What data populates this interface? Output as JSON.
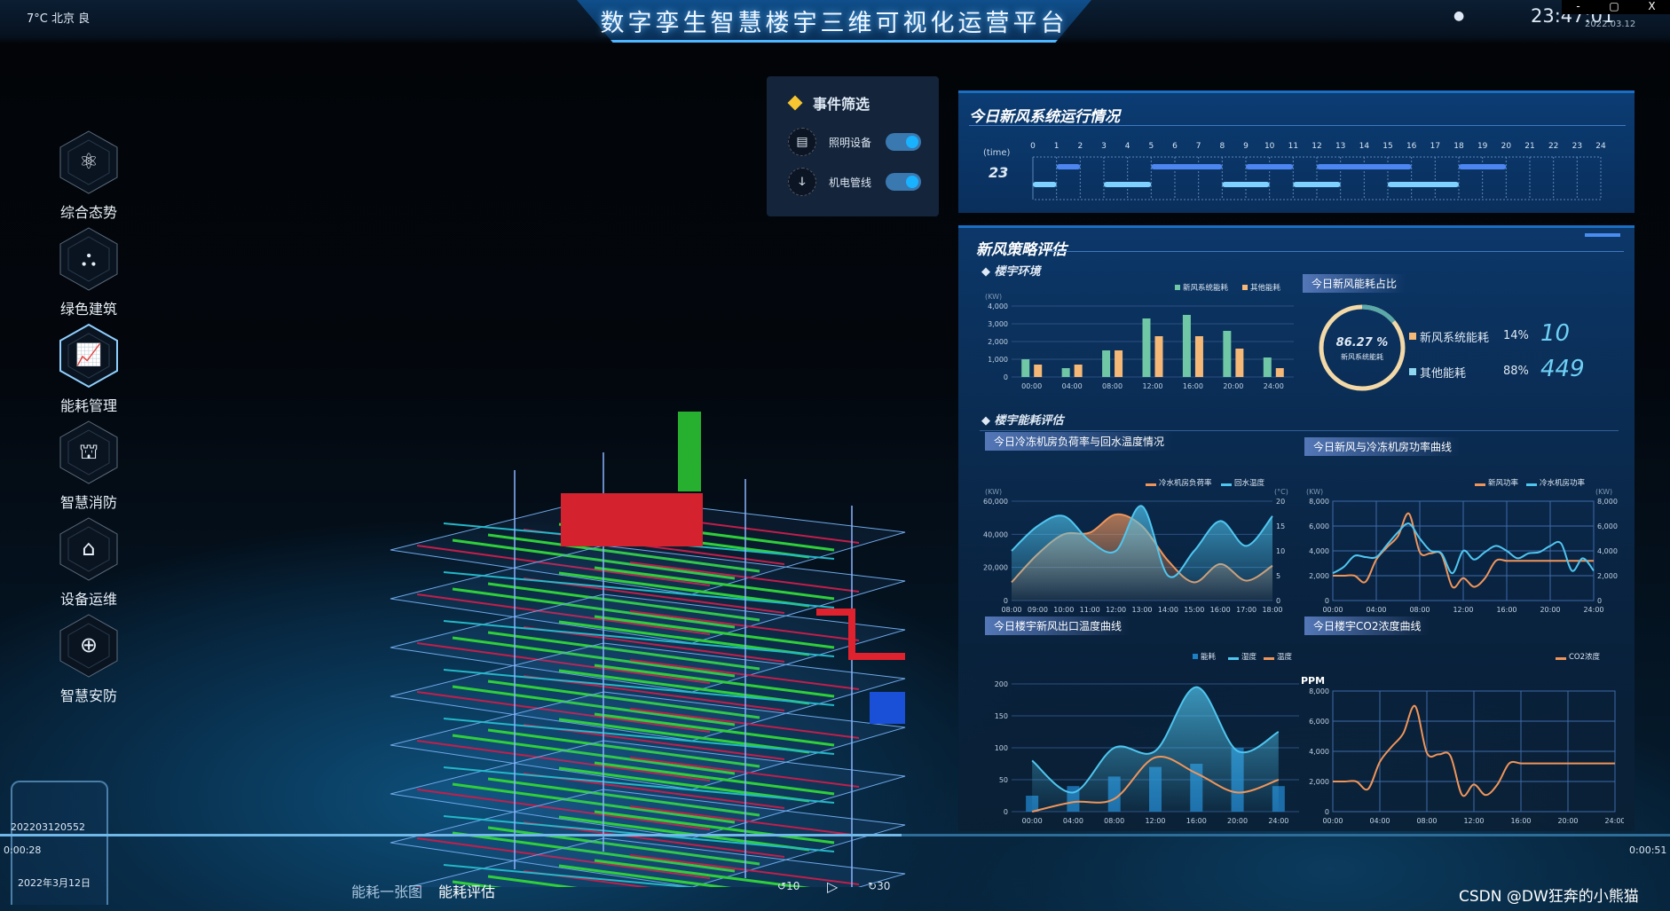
{
  "header": {
    "weather": "7°C 北京 良",
    "title": "数字孪生智慧楼宇三维可视化运营平台",
    "time": "23:47:01",
    "date": "2022.03.12",
    "location_icon": "map-pin-icon"
  },
  "window_controls": {
    "minimize": "-",
    "maximize": "▢",
    "close": "X"
  },
  "nav": {
    "items": [
      {
        "label": "综合态势",
        "icon": "atom-icon",
        "active": false
      },
      {
        "label": "绿色建筑",
        "icon": "nodes-icon",
        "active": false
      },
      {
        "label": "能耗管理",
        "icon": "monitor-chart-icon",
        "active": true
      },
      {
        "label": "智慧消防",
        "icon": "fire-hydrant-icon",
        "active": false
      },
      {
        "label": "设备运维",
        "icon": "router-icon",
        "active": false
      },
      {
        "label": "智慧安防",
        "icon": "target-icon",
        "active": false
      }
    ]
  },
  "event_filter": {
    "title": "事件筛选",
    "items": [
      {
        "label": "照明设备",
        "icon": "ac-unit-icon",
        "on": true
      },
      {
        "label": "机电管线",
        "icon": "pipe-icon",
        "on": true
      }
    ]
  },
  "run_panel": {
    "title": "今日新风系统运行情况",
    "time_label": "(time)",
    "current": "23",
    "hours": [
      "0",
      "1",
      "2",
      "3",
      "4",
      "5",
      "6",
      "7",
      "8",
      "9",
      "10",
      "11",
      "12",
      "13",
      "14",
      "15",
      "16",
      "17",
      "18",
      "19",
      "20",
      "21",
      "22",
      "23",
      "24"
    ],
    "row_top": [
      [
        1,
        2
      ],
      [
        5,
        8
      ],
      [
        9,
        11
      ],
      [
        12,
        16
      ],
      [
        18,
        20
      ]
    ],
    "row_bottom": [
      [
        0,
        1
      ],
      [
        3,
        5
      ],
      [
        8,
        10
      ],
      [
        11,
        13
      ],
      [
        15,
        18
      ]
    ],
    "colors": {
      "top": "#4d86f0",
      "bottom": "#7fd2ff"
    }
  },
  "strategy": {
    "title": "新风策略评估",
    "section_env": "楼宇环境",
    "section_energy": "楼宇能耗评估",
    "donut": {
      "title": "今日新风能耗占比",
      "center_value": "86.27 %",
      "center_label": "新风系统能耗",
      "items": [
        {
          "label": "新风系统能耗",
          "pct": "14%",
          "value": "10",
          "color": "#f5b877"
        },
        {
          "label": "其他能耗",
          "pct": "88%",
          "value": "449",
          "color": "#8fd6f0"
        }
      ],
      "share": 0.14
    },
    "chart_titles": [
      "今日冷冻机房负荷率与回水温度情况",
      "今日新风与冷冻机房功率曲线",
      "今日楼宇新风出口温度曲线",
      "今日楼宇CO2浓度曲线"
    ]
  },
  "player": {
    "stamp": "202203120552",
    "elapsed": "0:00:28",
    "duration": "0:00:51",
    "date": "2022年3月12日",
    "tabs": [
      "能耗一张图",
      "能耗评估"
    ],
    "skip_back": "10",
    "skip_forward": "30"
  },
  "watermark": "CSDN @DW狂奔的小熊猫",
  "chart_data": [
    {
      "type": "bar",
      "ylabel": "(KW)",
      "categories": [
        "00:00",
        "04:00",
        "08:00",
        "12:00",
        "16:00",
        "20:00",
        "24:00"
      ],
      "ylim": [
        0,
        4000
      ],
      "yticks": [
        "0",
        "1,000",
        "2,000",
        "3,000",
        "4,000"
      ],
      "grid": true,
      "legend": "top-right",
      "series": [
        {
          "name": "新风系统能耗",
          "values": [
            1000,
            500,
            1500,
            3300,
            3500,
            2600,
            1100
          ],
          "color": "#6fc7a6"
        },
        {
          "name": "其他能耗",
          "values": [
            700,
            700,
            1500,
            2300,
            2300,
            1600,
            500
          ],
          "color": "#f5b877"
        }
      ]
    },
    {
      "type": "area",
      "ylabel": "(KW)",
      "ylabel_right": "(°C)",
      "categories": [
        "08:00",
        "09:00",
        "10:00",
        "11:00",
        "12:00",
        "13:00",
        "14:00",
        "15:00",
        "16:00",
        "17:00",
        "18:00"
      ],
      "ylim": [
        0,
        60000
      ],
      "ylim_right": [
        0,
        20
      ],
      "yticks": [
        "0",
        "20,000",
        "40,000",
        "60,000"
      ],
      "yticks_right": [
        "0",
        "5",
        "10",
        "15",
        "20"
      ],
      "grid": true,
      "legend": "top-right",
      "series": [
        {
          "name": "冷水机房负荷率",
          "axis": "left",
          "values": [
            11000,
            28000,
            40000,
            41000,
            52000,
            45000,
            24000,
            11000,
            22000,
            12000,
            21000
          ],
          "color": "#f0955a"
        },
        {
          "name": "回水温度",
          "axis": "right",
          "values": [
            10,
            15,
            17,
            12,
            10,
            19,
            5,
            10,
            16,
            11,
            17
          ],
          "color": "#4fc6f0"
        }
      ]
    },
    {
      "type": "line",
      "ylabel": "(KW)",
      "ylabel_right": "(KW)",
      "categories": [
        "00:00",
        "04:00",
        "08:00",
        "12:00",
        "16:00",
        "20:00",
        "24:00"
      ],
      "x_hours": [
        0,
        24
      ],
      "ylim": [
        0,
        8000
      ],
      "ylim_right": [
        0,
        8000
      ],
      "yticks": [
        "0",
        "2,000",
        "4,000",
        "6,000",
        "8,000"
      ],
      "yticks_right": [
        "0",
        "2,000",
        "4,000",
        "6,000",
        "8,000"
      ],
      "grid": true,
      "legend": "top-right",
      "series": [
        {
          "name": "新风功率",
          "axis": "left",
          "values": [
            2000,
            2000,
            2000,
            1500,
            3300,
            4300,
            5200,
            7000,
            3900,
            3800,
            3700,
            1100,
            1800,
            1100,
            1800,
            3200,
            3200,
            3200,
            3200,
            3200,
            3200,
            3200,
            3200,
            3200,
            3200
          ],
          "color": "#f0955a"
        },
        {
          "name": "冷水机房功率",
          "axis": "right",
          "values": [
            2200,
            2700,
            3600,
            3500,
            3500,
            4500,
            5500,
            6200,
            5000,
            4000,
            3800,
            2200,
            4000,
            3300,
            3900,
            4400,
            4000,
            3400,
            3800,
            3900,
            4400,
            4600,
            2400,
            3400,
            2400
          ],
          "color": "#4fc6f0"
        }
      ]
    },
    {
      "type": "combo",
      "categories": [
        "00:00",
        "04:00",
        "08:00",
        "12:00",
        "16:00",
        "20:00",
        "24:00"
      ],
      "ylim": [
        0,
        200
      ],
      "yticks": [
        "0",
        "50",
        "100",
        "150",
        "200"
      ],
      "grid": true,
      "legend": "top-right",
      "series": [
        {
          "name": "能耗",
          "kind": "bar",
          "values": [
            25,
            40,
            55,
            70,
            75,
            100,
            40
          ],
          "color": "#1f7fc4"
        },
        {
          "name": "湿度",
          "kind": "area",
          "values": [
            80,
            30,
            100,
            95,
            195,
            95,
            125
          ],
          "color": "#4fc6f0"
        },
        {
          "name": "温度",
          "kind": "line",
          "values": [
            0,
            15,
            20,
            85,
            60,
            30,
            50
          ],
          "color": "#f0955a"
        }
      ]
    },
    {
      "type": "line",
      "ylabel": "PPM",
      "categories": [
        "00:00",
        "04:00",
        "08:00",
        "12:00",
        "16:00",
        "20:00",
        "24:00"
      ],
      "x_hours": [
        0,
        24
      ],
      "ylim": [
        0,
        8000
      ],
      "yticks": [
        "0",
        "2,000",
        "4,000",
        "6,000",
        "8,000"
      ],
      "grid": true,
      "legend": "top-right",
      "series": [
        {
          "name": "CO2浓度",
          "values": [
            2000,
            2000,
            2000,
            1500,
            3300,
            4300,
            5200,
            7000,
            3900,
            3800,
            3700,
            1100,
            1800,
            1100,
            1800,
            3200,
            3200,
            3200,
            3200,
            3200,
            3200,
            3200,
            3200,
            3200,
            3200
          ],
          "color": "#f0955a"
        }
      ]
    }
  ]
}
